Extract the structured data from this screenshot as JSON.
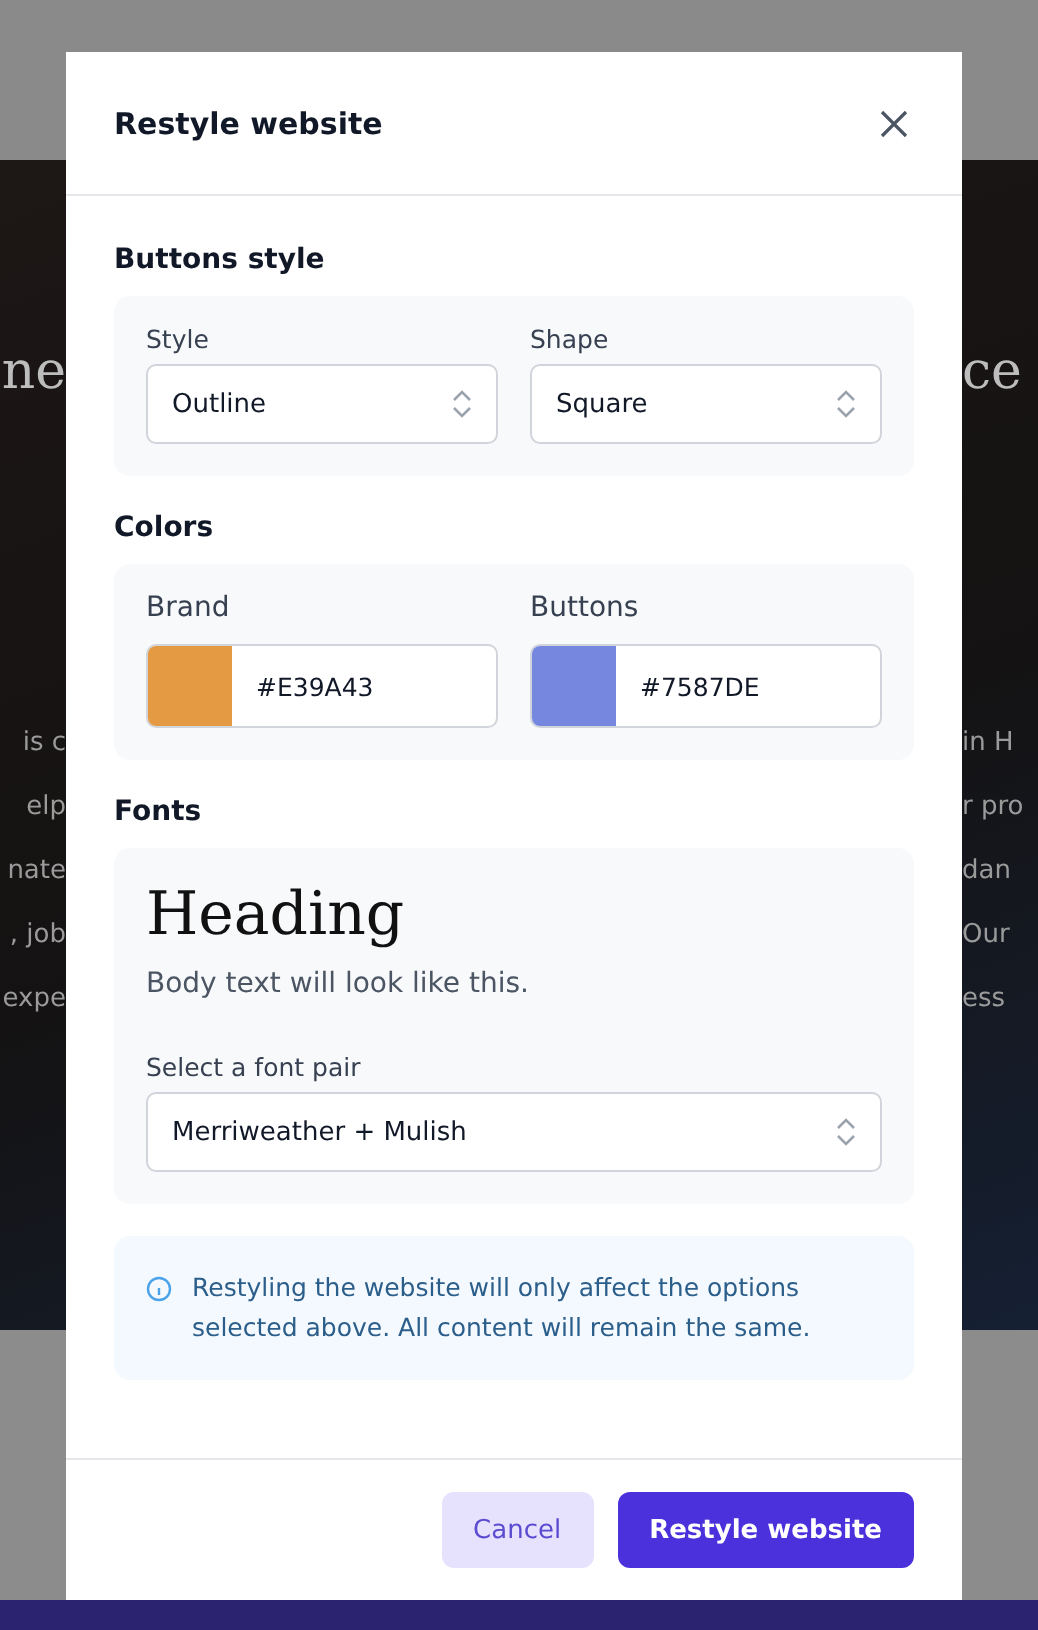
{
  "backdrop": {
    "headline_left": "ne",
    "headline_right": "ce",
    "lines_left": [
      "is c",
      "elp",
      "nate",
      ", job",
      "expe"
    ],
    "lines_right": [
      "in H",
      "r pro",
      "dan",
      "Our",
      "ess"
    ]
  },
  "dialog": {
    "title": "Restyle website",
    "sections": [
      {
        "kind": "selects",
        "title": "Buttons style",
        "fields": [
          {
            "label": "Style",
            "value": "Outline"
          },
          {
            "label": "Shape",
            "value": "Square"
          }
        ]
      },
      {
        "kind": "colors",
        "title": "Colors",
        "fields": [
          {
            "label": "Brand",
            "value": "#E39A43",
            "color": "#e39a43"
          },
          {
            "label": "Buttons",
            "value": "#7587DE",
            "color": "#7587de"
          }
        ]
      },
      {
        "kind": "fonts",
        "title": "Fonts",
        "heading": "Heading",
        "body": "Body text will look like this.",
        "select_label": "Select a font pair",
        "select_value": "Merriweather + Mulish"
      }
    ],
    "notice": "Restyling the website will only affect the options selected above. All content will remain the same.",
    "buttons": [
      {
        "label": "Cancel",
        "kind": "secondary"
      },
      {
        "label": "Restyle website",
        "kind": "primary"
      }
    ]
  }
}
